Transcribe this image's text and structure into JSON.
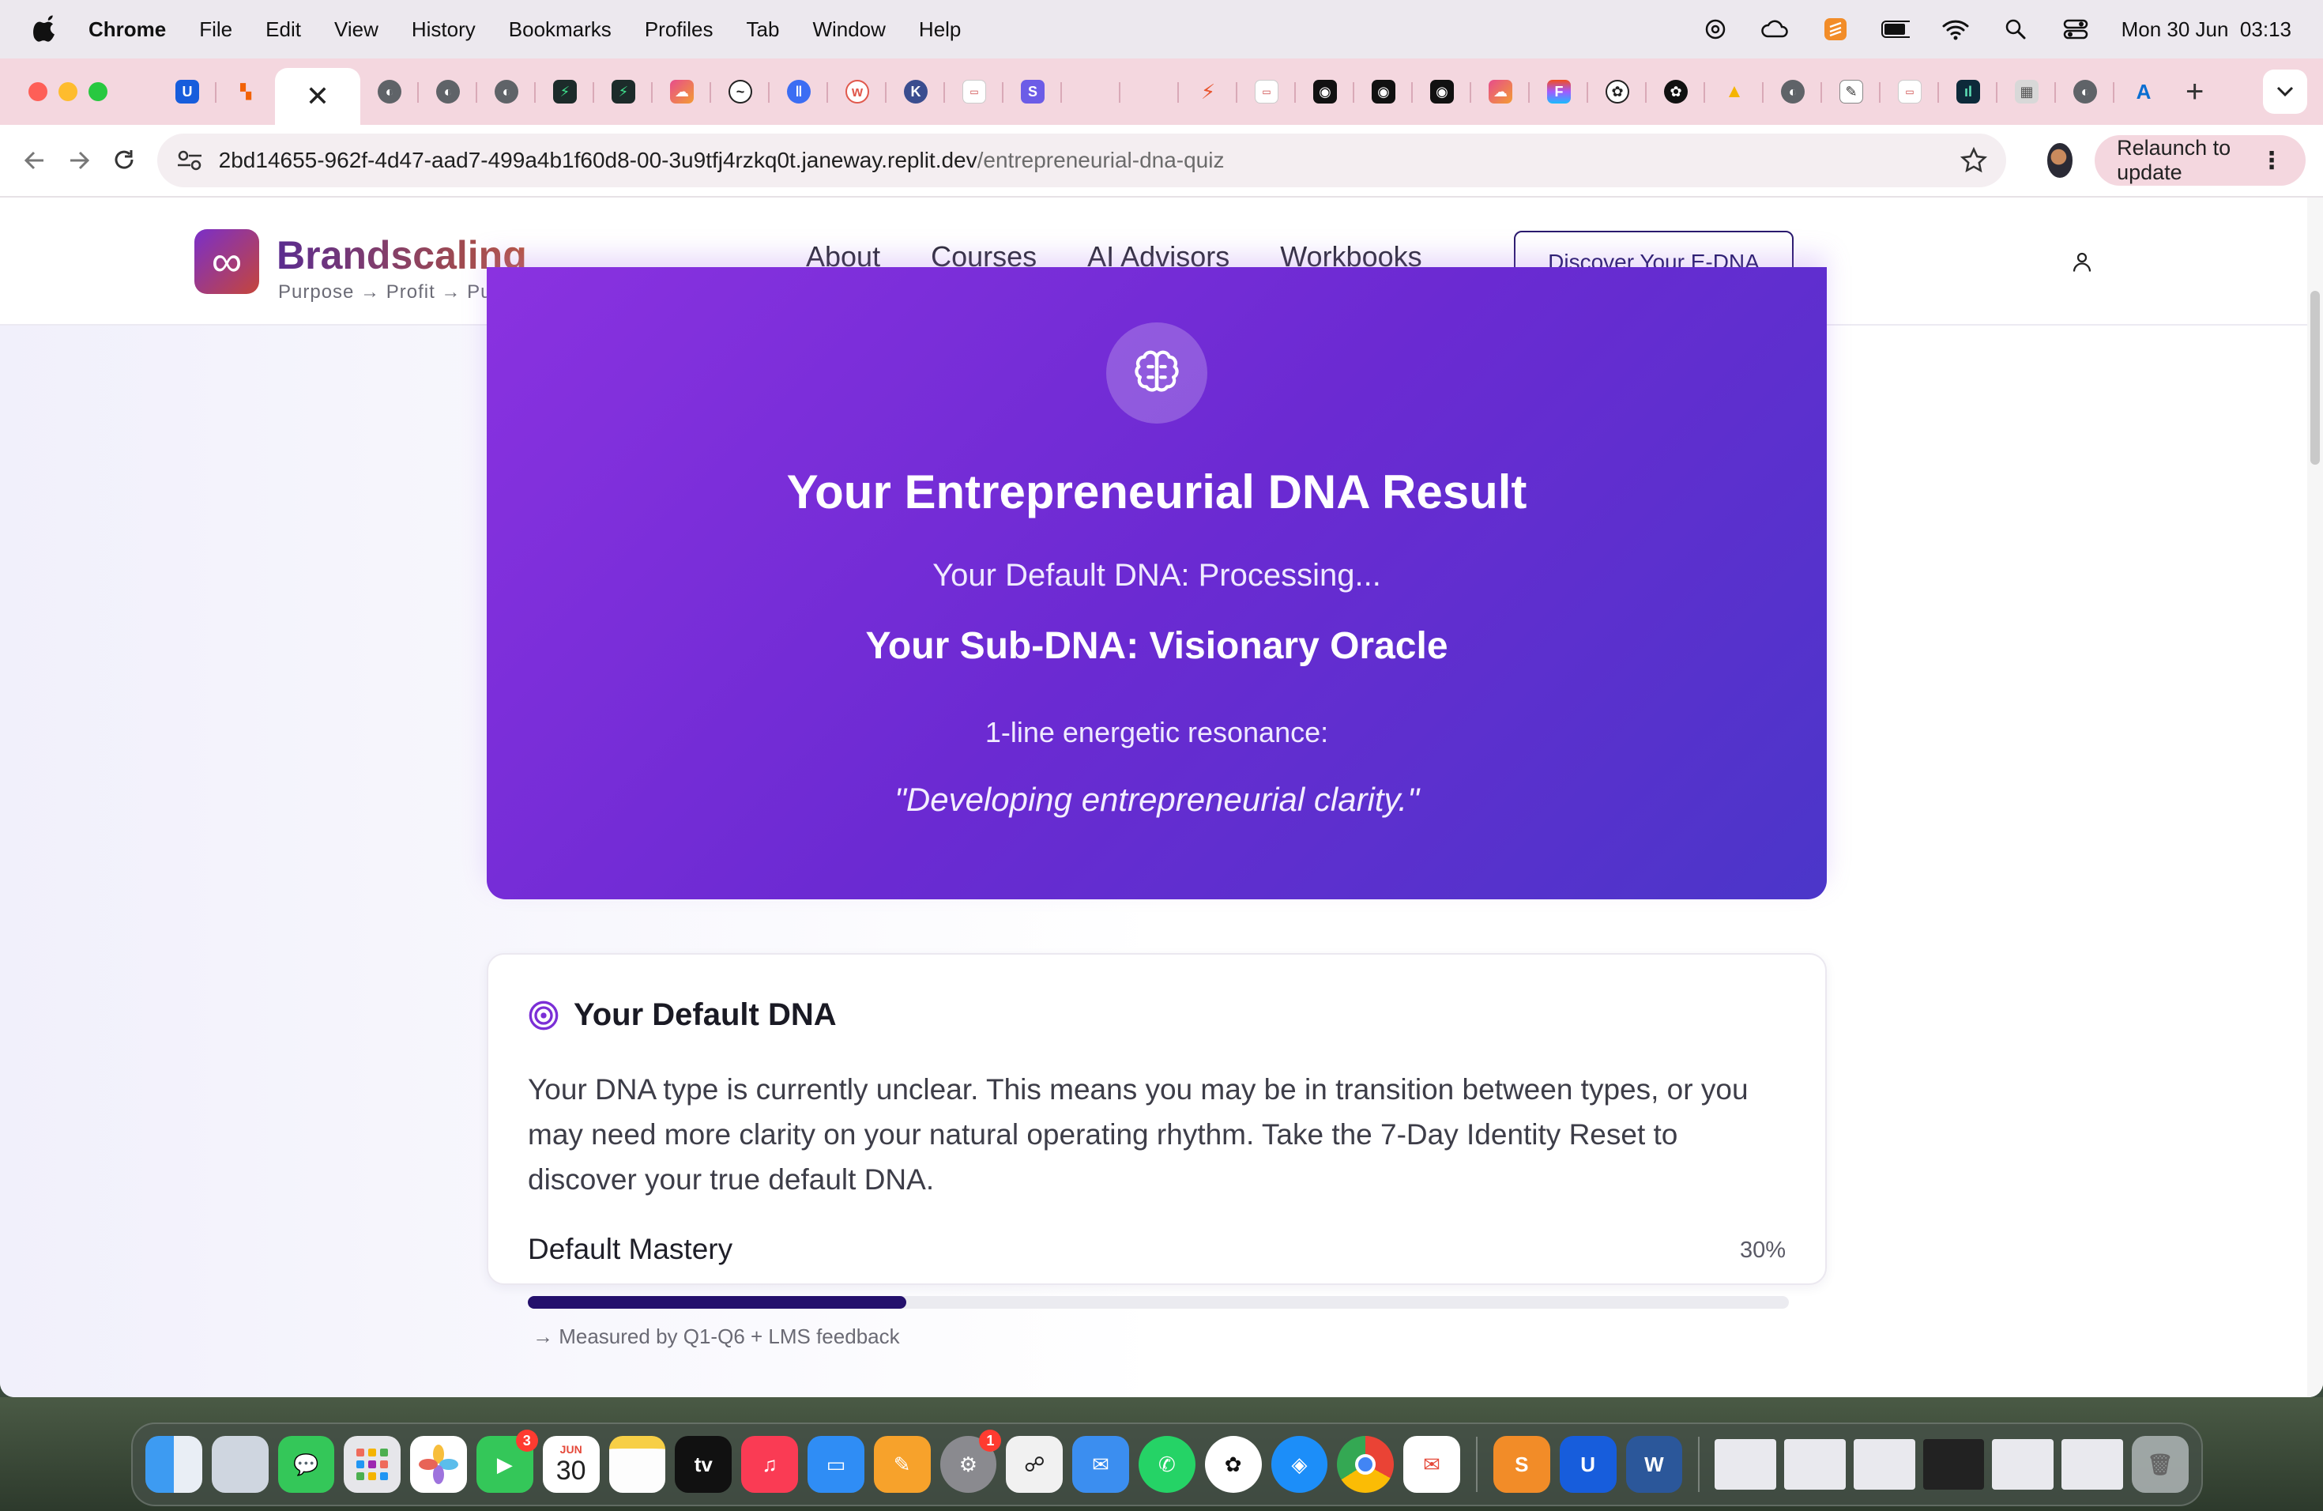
{
  "menubar": {
    "app_name": "Chrome",
    "menus": [
      "File",
      "Edit",
      "View",
      "History",
      "Bookmarks",
      "Profiles",
      "Tab",
      "Window",
      "Help"
    ],
    "clock": "Mon 30 Jun  03:13"
  },
  "browser": {
    "url_host": "2bd14655-962f-4d47-aad7-499a4b1f60d8-00-3u9tfj4rzkq0t.janeway.replit.dev",
    "url_path": "/entrepreneurial-dna-quiz",
    "relaunch_label": "Relaunch to update"
  },
  "site": {
    "brand_name": "Brandscaling",
    "brand_tagline": "Purpose → Profit → Purpose",
    "nav": {
      "about": "About",
      "courses": "Courses",
      "ai_advisors": "AI Advisors",
      "workbooks": "Workbooks"
    },
    "cta_label": "Discover Your E-DNA"
  },
  "result": {
    "title": "Your Entrepreneurial DNA Result",
    "default_dna": "Your Default DNA: Processing...",
    "sub_dna": "Your Sub-DNA: Visionary Oracle",
    "resonance_label": "1-line energetic resonance:",
    "resonance_quote": "\"Developing entrepreneurial clarity.\""
  },
  "default_card": {
    "heading": "Your Default DNA",
    "body": "Your DNA type is currently unclear. This means you may be in transition between types, or you may need more clarity on your natural operating rhythm. Take the 7-Day Identity Reset to discover your true default DNA.",
    "mastery_label": "Default Mastery",
    "mastery_value_text": "30%",
    "mastery_fraction": 0.3,
    "mastery_note": "→ Measured by Q1-Q6 + LMS feedback"
  },
  "dock": {
    "calendar_month": "JUN",
    "calendar_day": "30",
    "facetime_badge": "3",
    "settings_badge": "1"
  },
  "colors": {
    "accent": "#24106c",
    "card_gradient_start": "#8a32e0",
    "card_gradient_end": "#4b36c9",
    "tabstrip": "#f4d7df"
  }
}
